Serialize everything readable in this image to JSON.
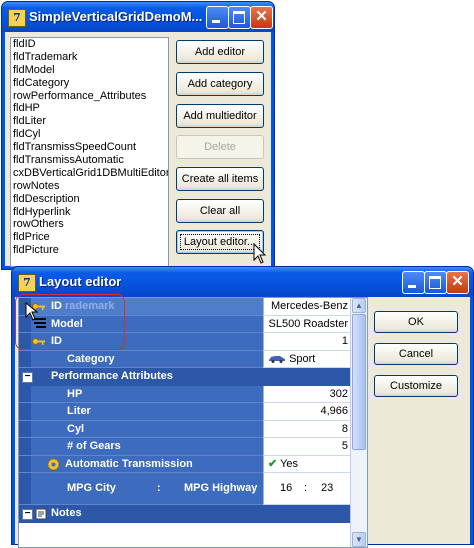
{
  "demo_window": {
    "title": "SimpleVerticalGridDemoM...",
    "app_icon": "dx-logo-icon",
    "list_items": [
      "fldID",
      "fldTrademark",
      "fldModel",
      "fldCategory",
      "rowPerformance_Attributes",
      "fldHP",
      "fldLiter",
      "fldCyl",
      "fldTransmissSpeedCount",
      "fldTransmissAutomatic",
      "cxDBVerticalGrid1DBMultiEditorF",
      "rowNotes",
      "fldDescription",
      "fldHyperlink",
      "rowOthers",
      "fldPrice",
      "fldPicture"
    ],
    "buttons": {
      "add_editor": "Add editor",
      "add_category": "Add category",
      "add_multieditor": "Add multieditor",
      "delete": "Delete",
      "create_all_items": "Create all items",
      "clear_all": "Clear all",
      "layout_editor": "Layout editor..."
    }
  },
  "layout_editor": {
    "title": "Layout editor",
    "buttons": {
      "ok": "OK",
      "cancel": "Cancel",
      "customize": "Customize"
    },
    "rows": {
      "trademark": {
        "label": "ID",
        "label_ghost": "rademark",
        "value": "Mercedes-Benz"
      },
      "model": {
        "label": "Model",
        "value": "SL500 Roadster"
      },
      "id": {
        "label": "ID",
        "value": "1"
      },
      "category": {
        "label": "Category",
        "value": "Sport"
      },
      "performance": {
        "label": "Performance Attributes"
      },
      "hp": {
        "label": "HP",
        "value": "302"
      },
      "liter": {
        "label": "Liter",
        "value": "4,966"
      },
      "cyl": {
        "label": "Cyl",
        "value": "8"
      },
      "gears": {
        "label": "# of Gears",
        "value": "5"
      },
      "automatic": {
        "label": "Automatic Transmission",
        "value": "Yes"
      },
      "mpg": {
        "city_label": "MPG City",
        "sep": ":",
        "highway_label": "MPG Highway",
        "city_value": "16",
        "value_sep": ":",
        "highway_value": "23"
      },
      "notes": {
        "label": "Notes"
      }
    }
  },
  "colors": {
    "xp_blue": "#0054e3",
    "grid_header": "#3d6bbd",
    "category": "#2d57a8",
    "highlight": "#c33333"
  }
}
